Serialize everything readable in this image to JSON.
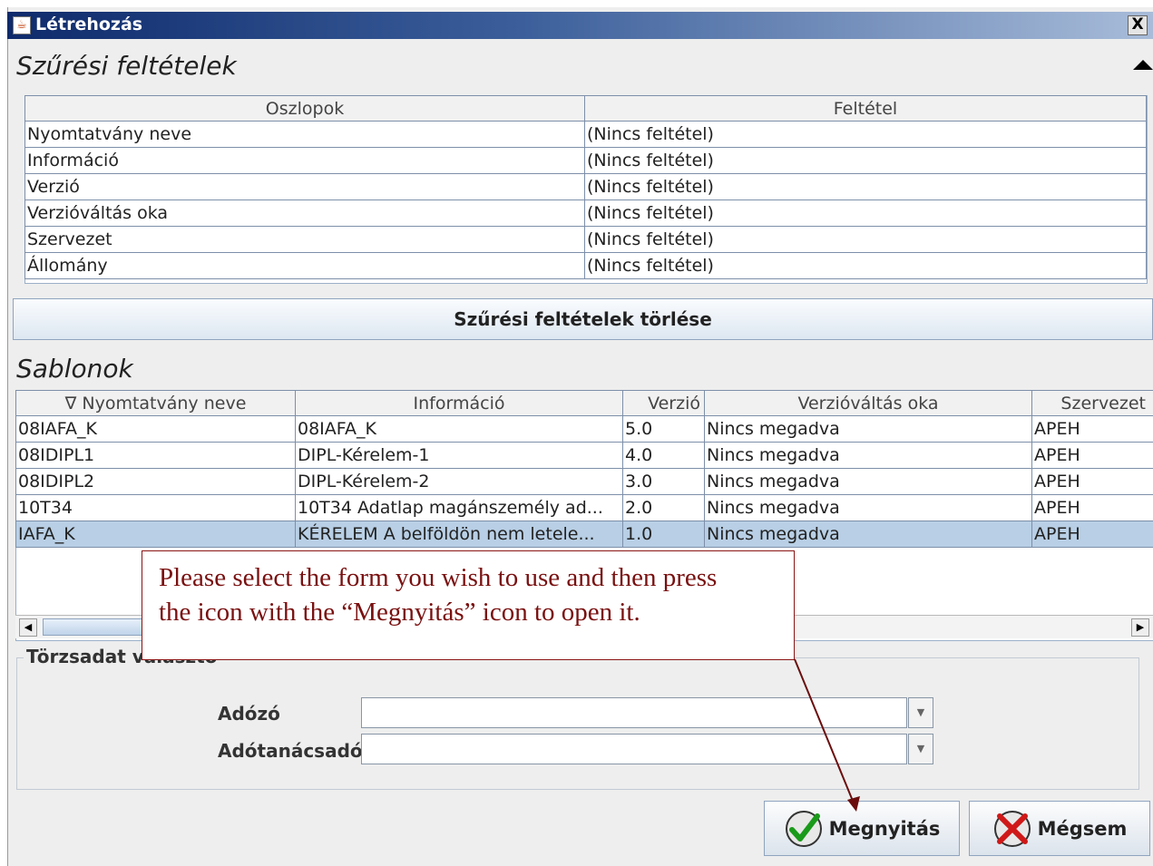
{
  "window": {
    "title": "Létrehozás",
    "close_label": "X"
  },
  "filter_section": {
    "title": "Szűrési feltételek",
    "columns": [
      "Oszlopok",
      "Feltétel"
    ],
    "rows": [
      [
        "Nyomtatvány neve",
        "(Nincs feltétel)"
      ],
      [
        "Információ",
        "(Nincs feltétel)"
      ],
      [
        "Verzió",
        "(Nincs feltétel)"
      ],
      [
        "Verzióváltás oka",
        "(Nincs feltétel)"
      ],
      [
        "Szervezet",
        "(Nincs feltétel)"
      ],
      [
        "Állomány",
        "(Nincs feltétel)"
      ]
    ],
    "clear_button": "Szűrési feltételek törlése"
  },
  "templates_section": {
    "title": "Sablonok",
    "sort_indicator": "∇",
    "columns": [
      "Nyomtatvány neve",
      "Információ",
      "Verzió",
      "Verzióváltás oka",
      "Szervezet"
    ],
    "rows": [
      [
        "08IAFA_K",
        "08IAFA_K",
        "5.0",
        "Nincs megadva",
        "APEH"
      ],
      [
        "08IDIPL1",
        "DIPL-Kérelem-1",
        "4.0",
        "Nincs megadva",
        "APEH"
      ],
      [
        "08IDIPL2",
        "DIPL-Kérelem-2",
        "3.0",
        "Nincs megadva",
        "APEH"
      ],
      [
        "10T34",
        "10T34 Adatlap magánszemély ad...",
        "2.0",
        "Nincs megadva",
        "APEH"
      ],
      [
        "IAFA_K",
        "KÉRELEM A belföldön nem letele...",
        "1.0",
        "Nincs megadva",
        "APEH"
      ]
    ],
    "selected_row": 4
  },
  "master_data": {
    "title": "Törzsadat választó",
    "adozo_label": "Adózó",
    "adozo_value": "",
    "adotanacsado_label": "Adótanácsadó",
    "adotanacsado_value": ""
  },
  "buttons": {
    "open": "Megnyitás",
    "cancel": "Mégsem"
  },
  "callout": {
    "line1": "Please select the form you wish to use and then press",
    "line2": "the icon with the “Megnyitás” icon to open it."
  }
}
